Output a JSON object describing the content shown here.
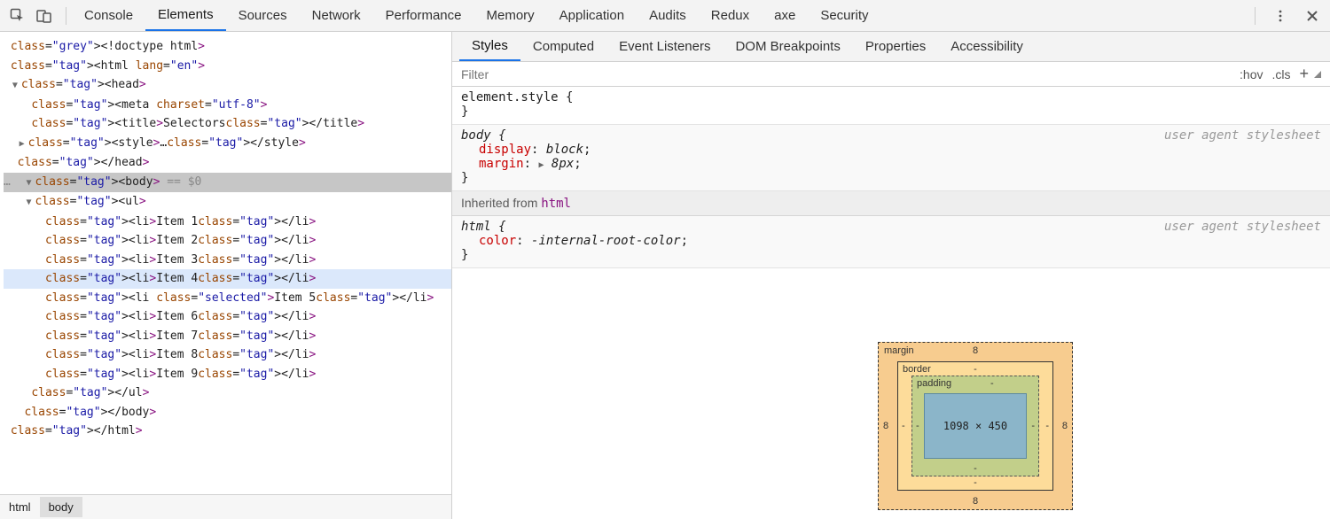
{
  "toolbar": {
    "tabs": [
      "Console",
      "Elements",
      "Sources",
      "Network",
      "Performance",
      "Memory",
      "Application",
      "Audits",
      "Redux",
      "axe",
      "Security"
    ],
    "active_tab": 1
  },
  "dom": {
    "doctype": "<!doctype html>",
    "html_open": "<html lang=\"en\">",
    "head_open": "<head>",
    "meta": "<meta charset=\"utf-8\">",
    "title_open": "<title>",
    "title_text": "Selectors",
    "title_close": "</title>",
    "style_collapsed": "<style>…</style>",
    "head_close": "</head>",
    "body_line_prefix": "…",
    "body_open": "<body>",
    "body_suffix": " == $0",
    "ul_open": "<ul>",
    "items": [
      {
        "text": "Item 1"
      },
      {
        "text": "Item 2"
      },
      {
        "text": "Item 3"
      },
      {
        "text": "Item 4"
      },
      {
        "text": "Item 5",
        "class": "selected"
      },
      {
        "text": "Item 6"
      },
      {
        "text": "Item 7"
      },
      {
        "text": "Item 8"
      },
      {
        "text": "Item 9"
      }
    ],
    "ul_close": "</ul>",
    "body_close": "</body>",
    "html_close": "</html>",
    "hovered_index": 3
  },
  "breadcrumbs": [
    "html",
    "body"
  ],
  "breadcrumb_active": 1,
  "sub_tabs": [
    "Styles",
    "Computed",
    "Event Listeners",
    "DOM Breakpoints",
    "Properties",
    "Accessibility"
  ],
  "sub_active": 0,
  "filter": {
    "placeholder": "Filter",
    "hov": ":hov",
    "cls": ".cls",
    "plus": "+"
  },
  "styles": {
    "element_style": {
      "selector": "element.style {",
      "close": "}"
    },
    "body_rule": {
      "selector": "body {",
      "origin": "user agent stylesheet",
      "props": [
        {
          "name": "display",
          "value": "block"
        },
        {
          "name": "margin",
          "value": "8px",
          "expand": true
        }
      ],
      "close": "}"
    },
    "inherited_label": "Inherited from ",
    "inherited_from": "html",
    "html_rule": {
      "selector": "html {",
      "origin": "user agent stylesheet",
      "props": [
        {
          "name": "color",
          "value": "-internal-root-color"
        }
      ],
      "close": "}"
    }
  },
  "box_model": {
    "margin": {
      "label": "margin",
      "top": "8",
      "right": "8",
      "bottom": "8",
      "left": "8"
    },
    "border": {
      "label": "border",
      "top": "-",
      "right": "-",
      "bottom": "-",
      "left": "-"
    },
    "padding": {
      "label": "padding",
      "val": "-",
      "right": "-",
      "bottom": "-",
      "left": "-"
    },
    "content": "1098 × 450"
  }
}
